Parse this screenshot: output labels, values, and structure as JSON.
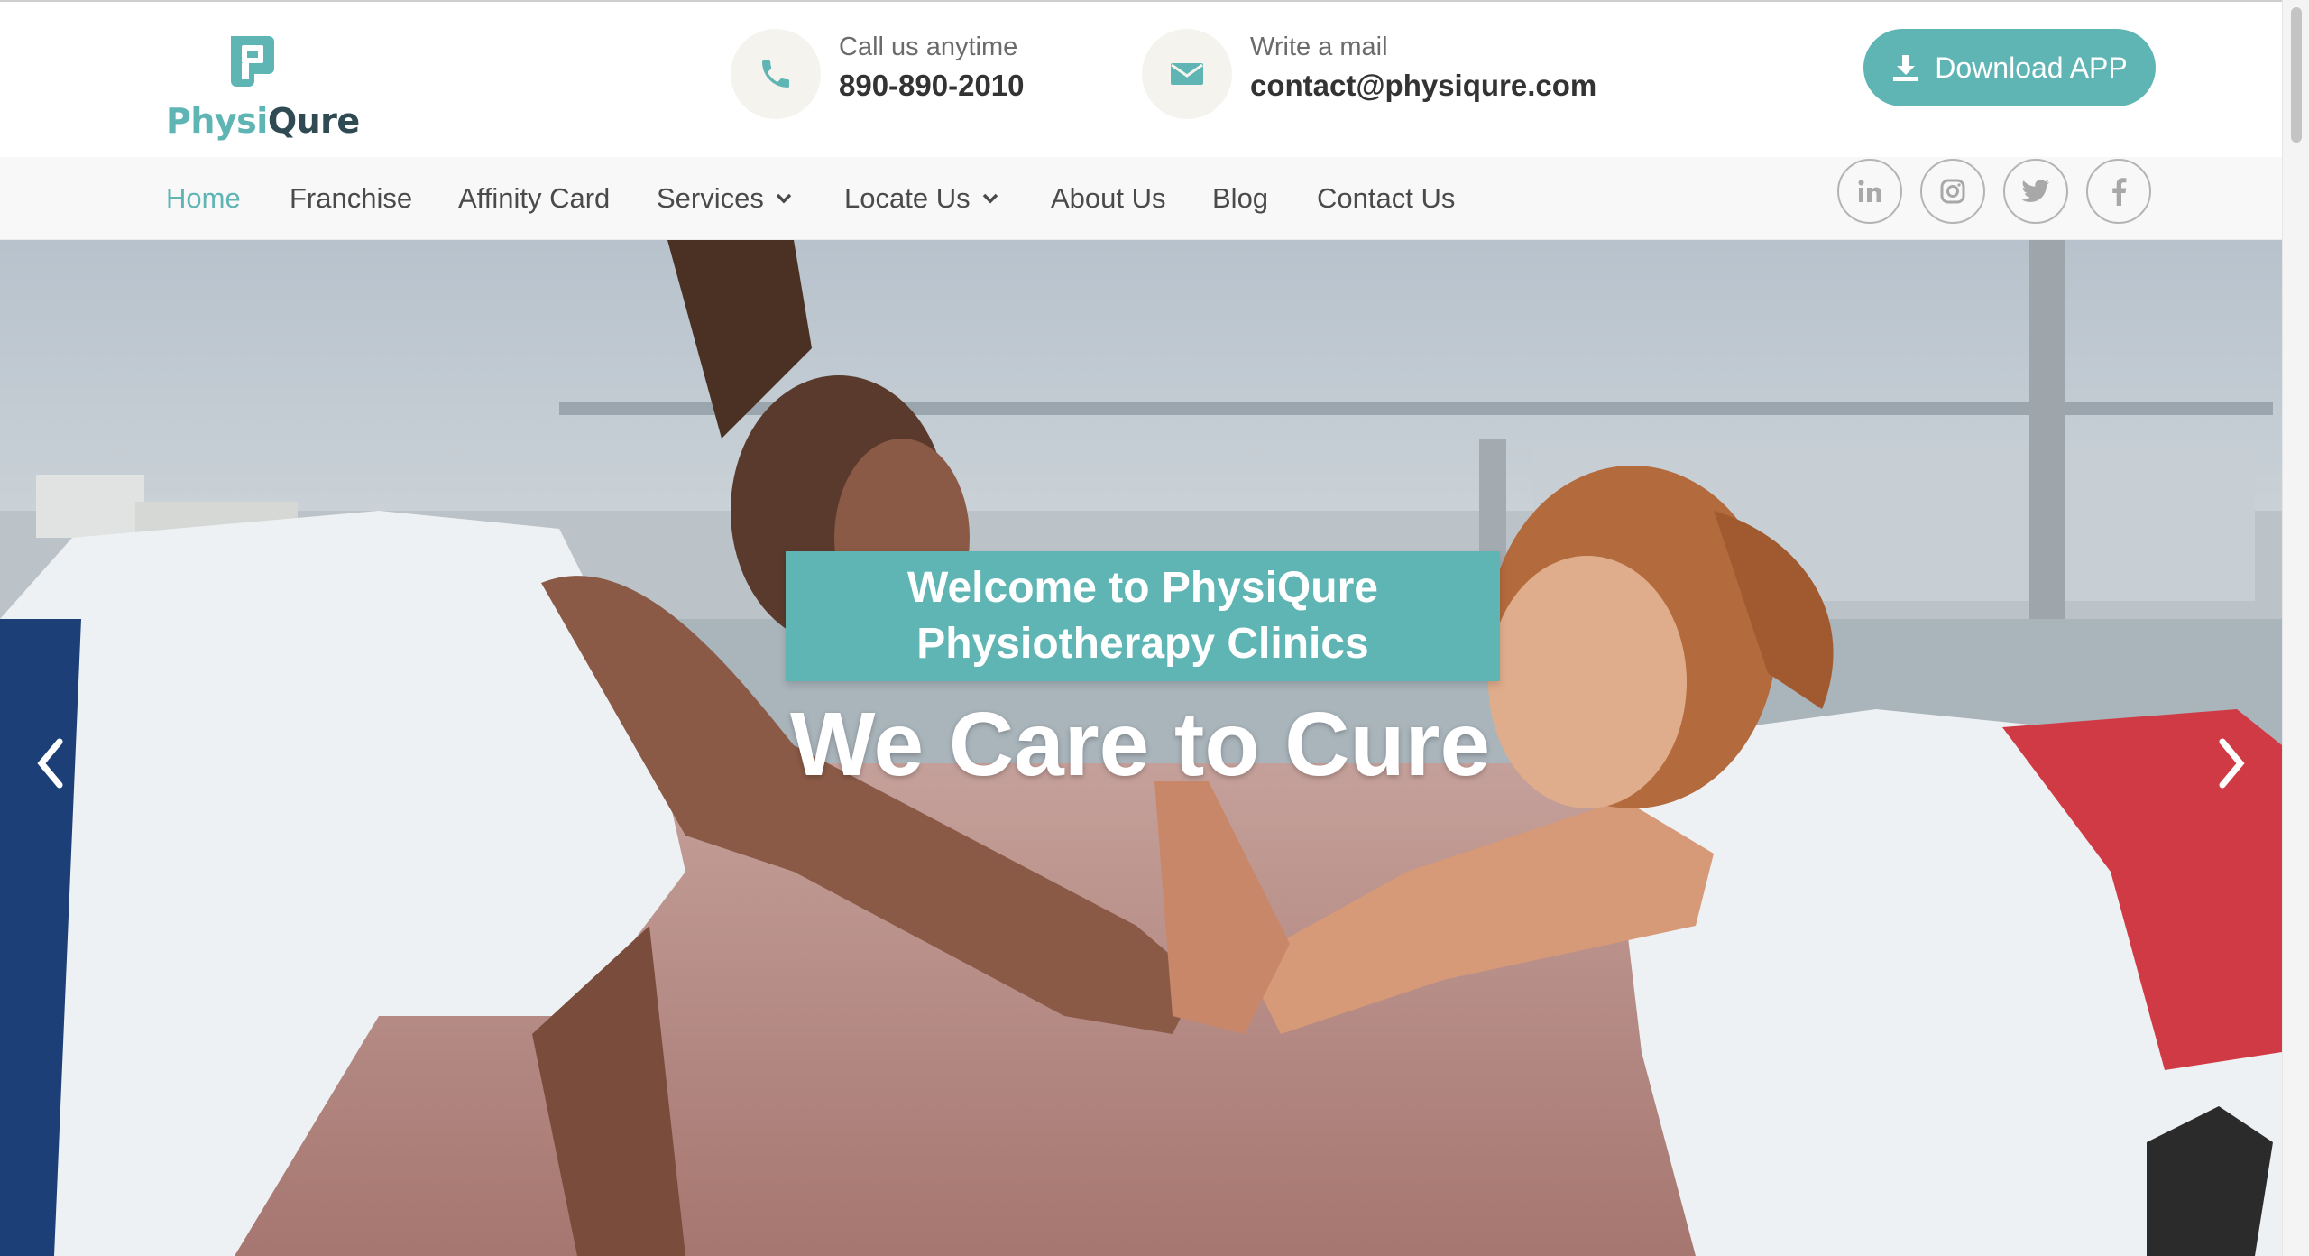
{
  "brand": {
    "name_part1": "Physi",
    "name_part2": "Qure",
    "primary_color": "#5fb4b4",
    "dark_color": "#2f4a52"
  },
  "header": {
    "phone": {
      "label": "Call us anytime",
      "value": "890-890-2010",
      "icon": "phone-icon"
    },
    "mail": {
      "label": "Write a mail",
      "value": "contact@physiqure.com",
      "icon": "envelope-icon"
    },
    "download_label": "Download APP"
  },
  "nav": {
    "items": [
      {
        "label": "Home",
        "active": true
      },
      {
        "label": "Franchise"
      },
      {
        "label": "Affinity Card"
      },
      {
        "label": "Services",
        "dropdown": true
      },
      {
        "label": "Locate Us",
        "dropdown": true
      },
      {
        "label": "About Us"
      },
      {
        "label": "Blog"
      },
      {
        "label": "Contact Us"
      }
    ],
    "social": [
      "linkedin-icon",
      "instagram-icon",
      "twitter-icon",
      "facebook-icon"
    ]
  },
  "hero": {
    "welcome": "Welcome to PhysiQure Physiotherapy Clinics",
    "tagline": "We Care to Cure"
  }
}
